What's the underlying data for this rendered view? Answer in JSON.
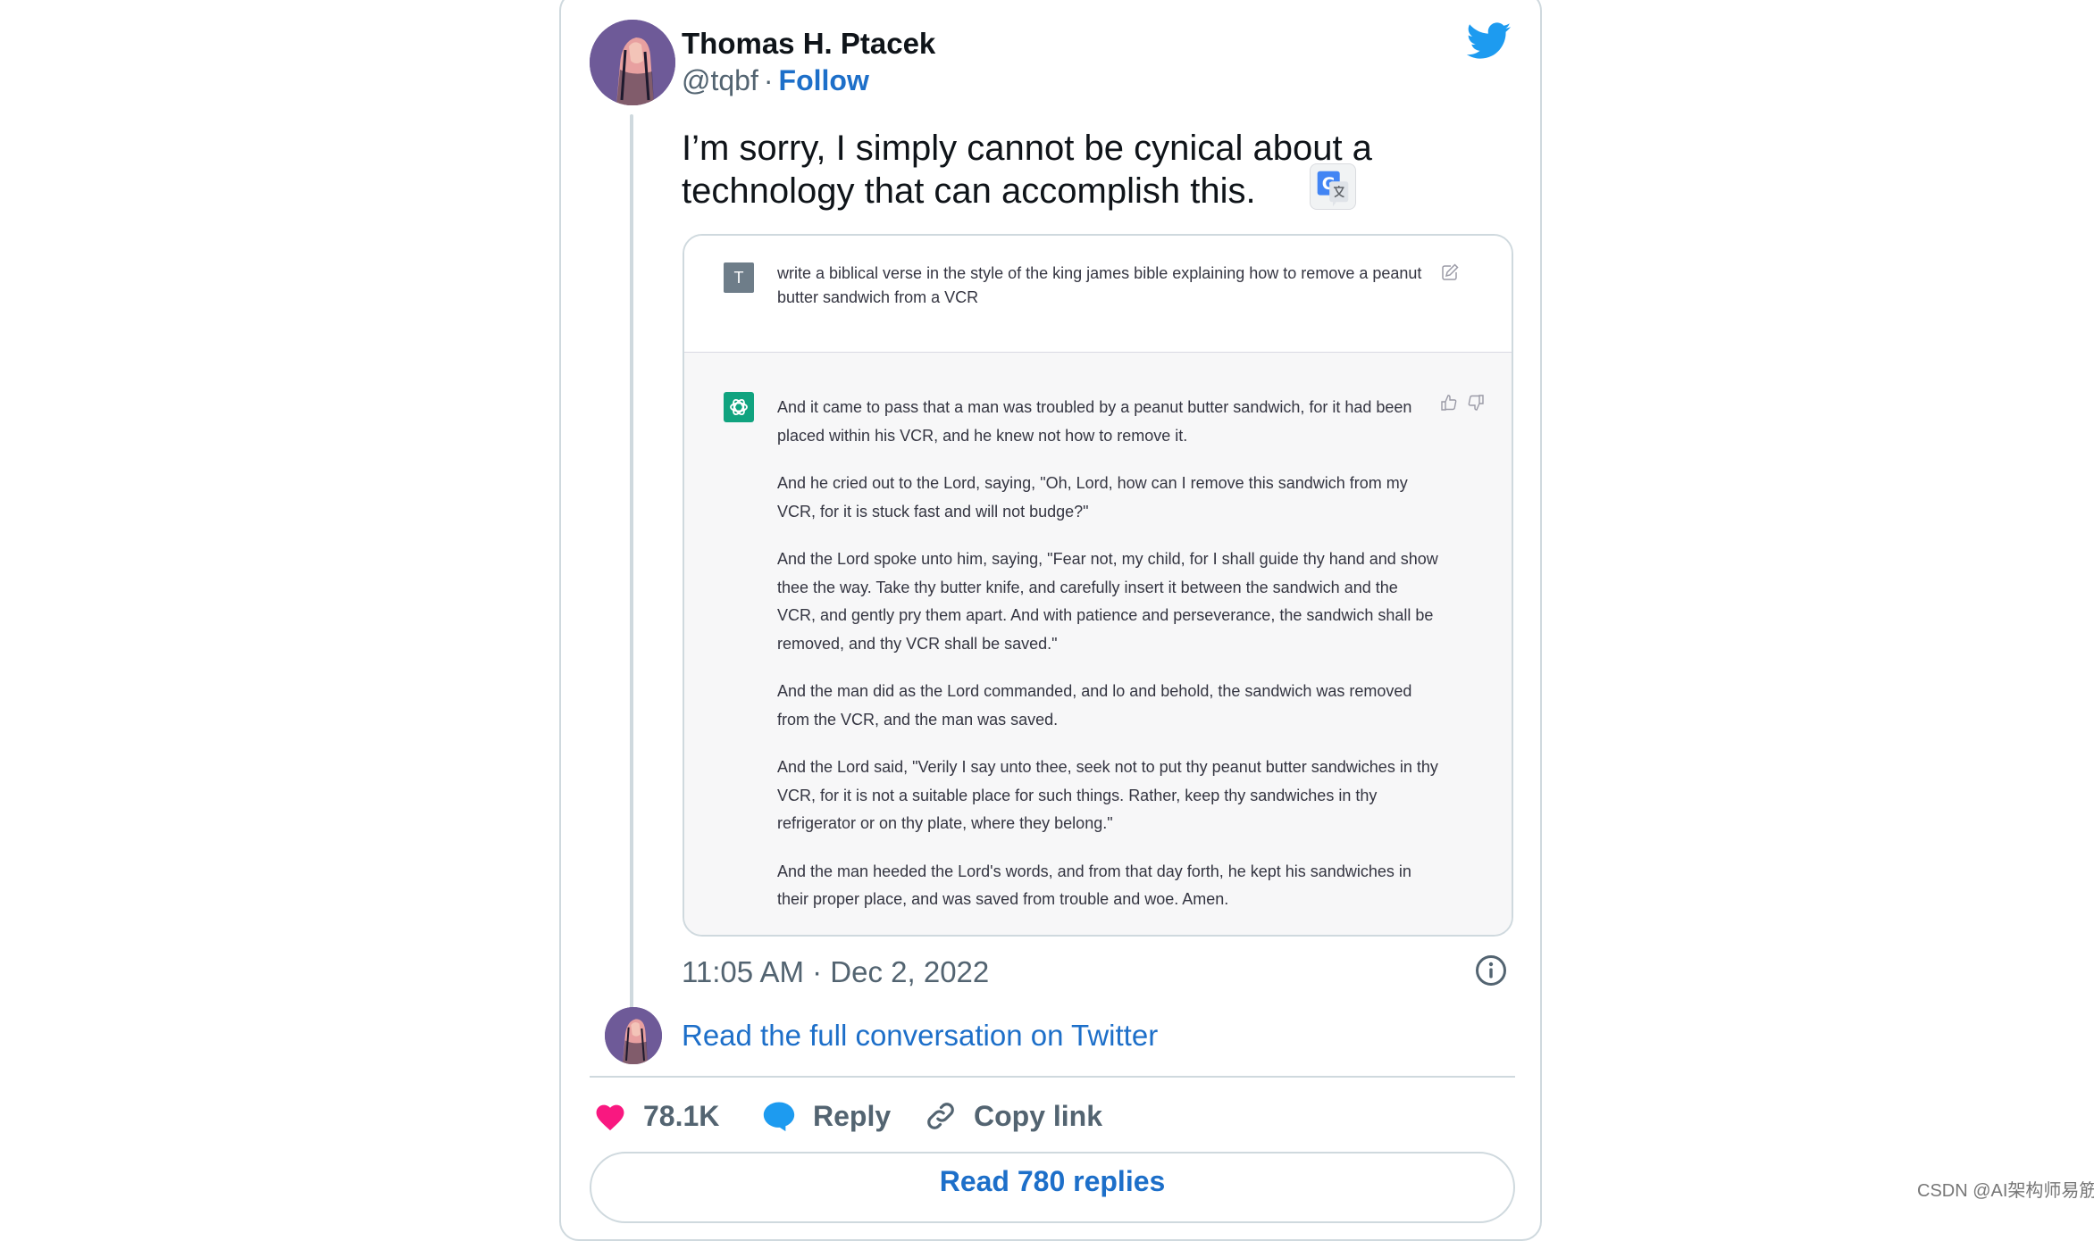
{
  "author": {
    "name": "Thomas H. Ptacek",
    "handle": "@tqbf",
    "separator": "·",
    "follow_label": "Follow"
  },
  "tweet": {
    "text_line1": "I’m sorry, I simply cannot be cynical about a",
    "text_line2": "technology that can accomplish this."
  },
  "screenshot": {
    "user_initial": "T",
    "prompt": "write a biblical verse in the style of the king james bible explaining how to remove a peanut butter sandwich from a VCR",
    "answer_paragraphs": [
      "And it came to pass that a man was troubled by a peanut butter sandwich, for it had been placed within his VCR, and he knew not how to remove it.",
      "And he cried out to the Lord, saying, \"Oh, Lord, how can I remove this sandwich from my VCR, for it is stuck fast and will not budge?\"",
      "And the Lord spoke unto him, saying, \"Fear not, my child, for I shall guide thy hand and show thee the way. Take thy butter knife, and carefully insert it between the sandwich and the VCR, and gently pry them apart. And with patience and perseverance, the sandwich shall be removed, and thy VCR shall be saved.\"",
      "And the man did as the Lord commanded, and lo and behold, the sandwich was removed from the VCR, and the man was saved.",
      "And the Lord said, \"Verily I say unto thee, seek not to put thy peanut butter sandwiches in thy VCR, for it is not a suitable place for such things. Rather, keep thy sandwiches in thy refrigerator or on thy plate, where they belong.\"",
      "And the man heeded the Lord's words, and from that day forth, he kept his sandwiches in their proper place, and was saved from trouble and woe. Amen."
    ]
  },
  "meta": {
    "timestamp": "11:05 AM · Dec 2, 2022",
    "read_conversation": "Read the full conversation on Twitter"
  },
  "actions": {
    "likes": "78.1K",
    "reply_label": "Reply",
    "copy_link_label": "Copy link",
    "read_replies": "Read 780 replies"
  },
  "watermark": "CSDN @AI架构师易筋",
  "icons": {
    "brand": "twitter-bird-icon",
    "translate": "google-translate-icon",
    "edit": "pencil-edit-icon",
    "chatgpt": "openai-logo-icon",
    "thumbs_up": "thumbs-up-icon",
    "thumbs_down": "thumbs-down-icon",
    "info": "info-icon",
    "like": "heart-icon",
    "reply": "speech-bubble-icon",
    "link": "link-icon"
  },
  "colors": {
    "twitter_blue": "#1d9bf0",
    "link_blue": "#1d6fc9",
    "like_pink": "#f91880",
    "chatgpt_green": "#10a37f",
    "muted_text": "#536471"
  }
}
